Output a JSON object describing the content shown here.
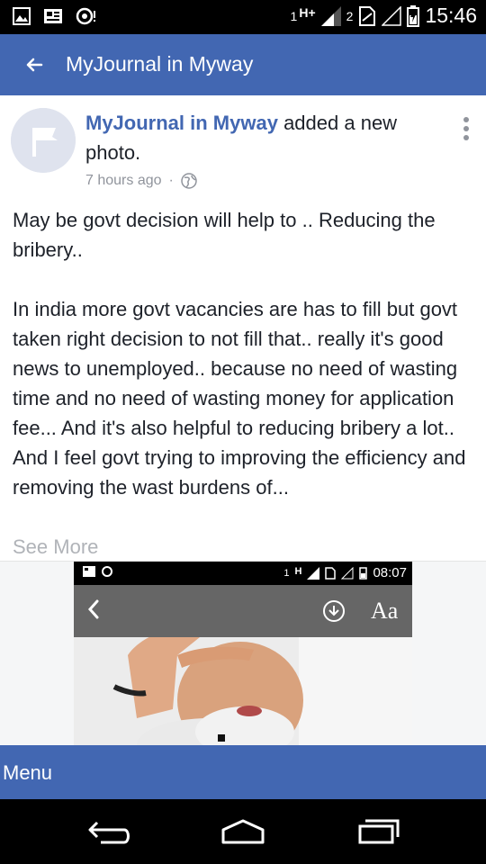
{
  "status_bar": {
    "sim1_label": "1",
    "network_type": "H+",
    "sim2_label": "2",
    "time": "15:46"
  },
  "app_bar": {
    "title": "MyJournal in Myway"
  },
  "post": {
    "author": "MyJournal in Myway",
    "action": " added a new photo.",
    "time_ago": "7 hours ago",
    "separator": "·",
    "body_line1": "May be govt decision will help to .. Reducing the bribery..",
    "body_paragraph2": "In india more govt vacancies are has to fill but govt taken right decision to not fill that.. really it's good news to unemployed.. because no need of wasting time and no need of wasting money for application fee... And it's also helpful to reducing bribery a lot..",
    "body_paragraph3": "And I feel govt trying to improving the efficiency and removing the wast burdens of...",
    "see_more": "See More"
  },
  "photo_screenshot": {
    "sim_label": "1",
    "network_type": "H",
    "time": "08:07",
    "font_button": "Aa"
  },
  "bottom_menu": {
    "label": "Menu"
  },
  "icons": {
    "back": "arrow-left-icon",
    "more": "vertical-dots-icon",
    "globe": "globe-icon",
    "nav_back": "nav-back-icon",
    "nav_home": "nav-home-icon",
    "nav_recents": "nav-recents-icon"
  },
  "colors": {
    "brand_blue": "#4267b2",
    "author_blue": "#4267b2",
    "meta_gray": "#90949c",
    "see_more_gray": "#b0b3b8"
  }
}
